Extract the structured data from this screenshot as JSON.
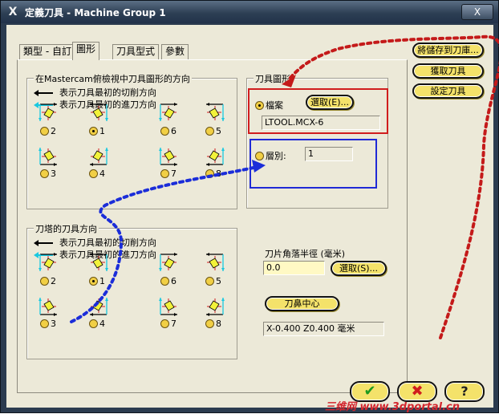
{
  "window": {
    "title": "定義刀具 - Machine Group 1",
    "app_icon": "X",
    "close_glyph": "X"
  },
  "tabs": [
    {
      "label": "類型 - 自訂"
    },
    {
      "label": "圖形"
    },
    {
      "label": "刀具型式"
    },
    {
      "label": "參數"
    }
  ],
  "top_section": {
    "title": "在Mastercam俯檢視中刀具圖形的方向",
    "legend_black": "表示刀具最初的切削方向",
    "legend_cyan": "表示刀具最初的進刀方向",
    "options": [
      "2",
      "1",
      "6",
      "5",
      "3",
      "4",
      "7",
      "8"
    ],
    "selected": "1"
  },
  "turret_section": {
    "title": "刀塔的刀具方向",
    "legend_black": "表示刀具最初的切削方向",
    "legend_cyan": "表示刀具最初的進刀方向",
    "options": [
      "2",
      "1",
      "6",
      "5",
      "3",
      "4",
      "7",
      "8"
    ],
    "selected": "1"
  },
  "tool_graphic": {
    "title": "刀具圖形",
    "file_option_label": "檔案",
    "select_file_button": "選取(E)...",
    "file_path": "LTOOL.MCX-6",
    "layer_option_label": "層別:",
    "layer_value": "1"
  },
  "nose": {
    "radius_label": "刀片角落半徑 (毫米)",
    "radius_value": "0.0",
    "select_button": "選取(S)...",
    "center_button": "刀鼻中心",
    "center_readout": "X-0.400 Z0.400 毫米"
  },
  "side_buttons": {
    "save_to_library": "將儲存到刀庫...",
    "get_tool": "獲取刀具",
    "set_tool": "設定刀具"
  },
  "bottom_buttons": {
    "ok_glyph": "✔",
    "cancel_glyph": "✖",
    "help_glyph": "?"
  },
  "watermark": "三维网 www.3dportal.cn",
  "colors": {
    "accent_yellow": "#f4e26a",
    "red_highlight": "#d01d1d",
    "blue_highlight": "#1f2ad6",
    "cyan_arrow": "#19c8e0",
    "insert_yellow": "#f2f23a"
  }
}
